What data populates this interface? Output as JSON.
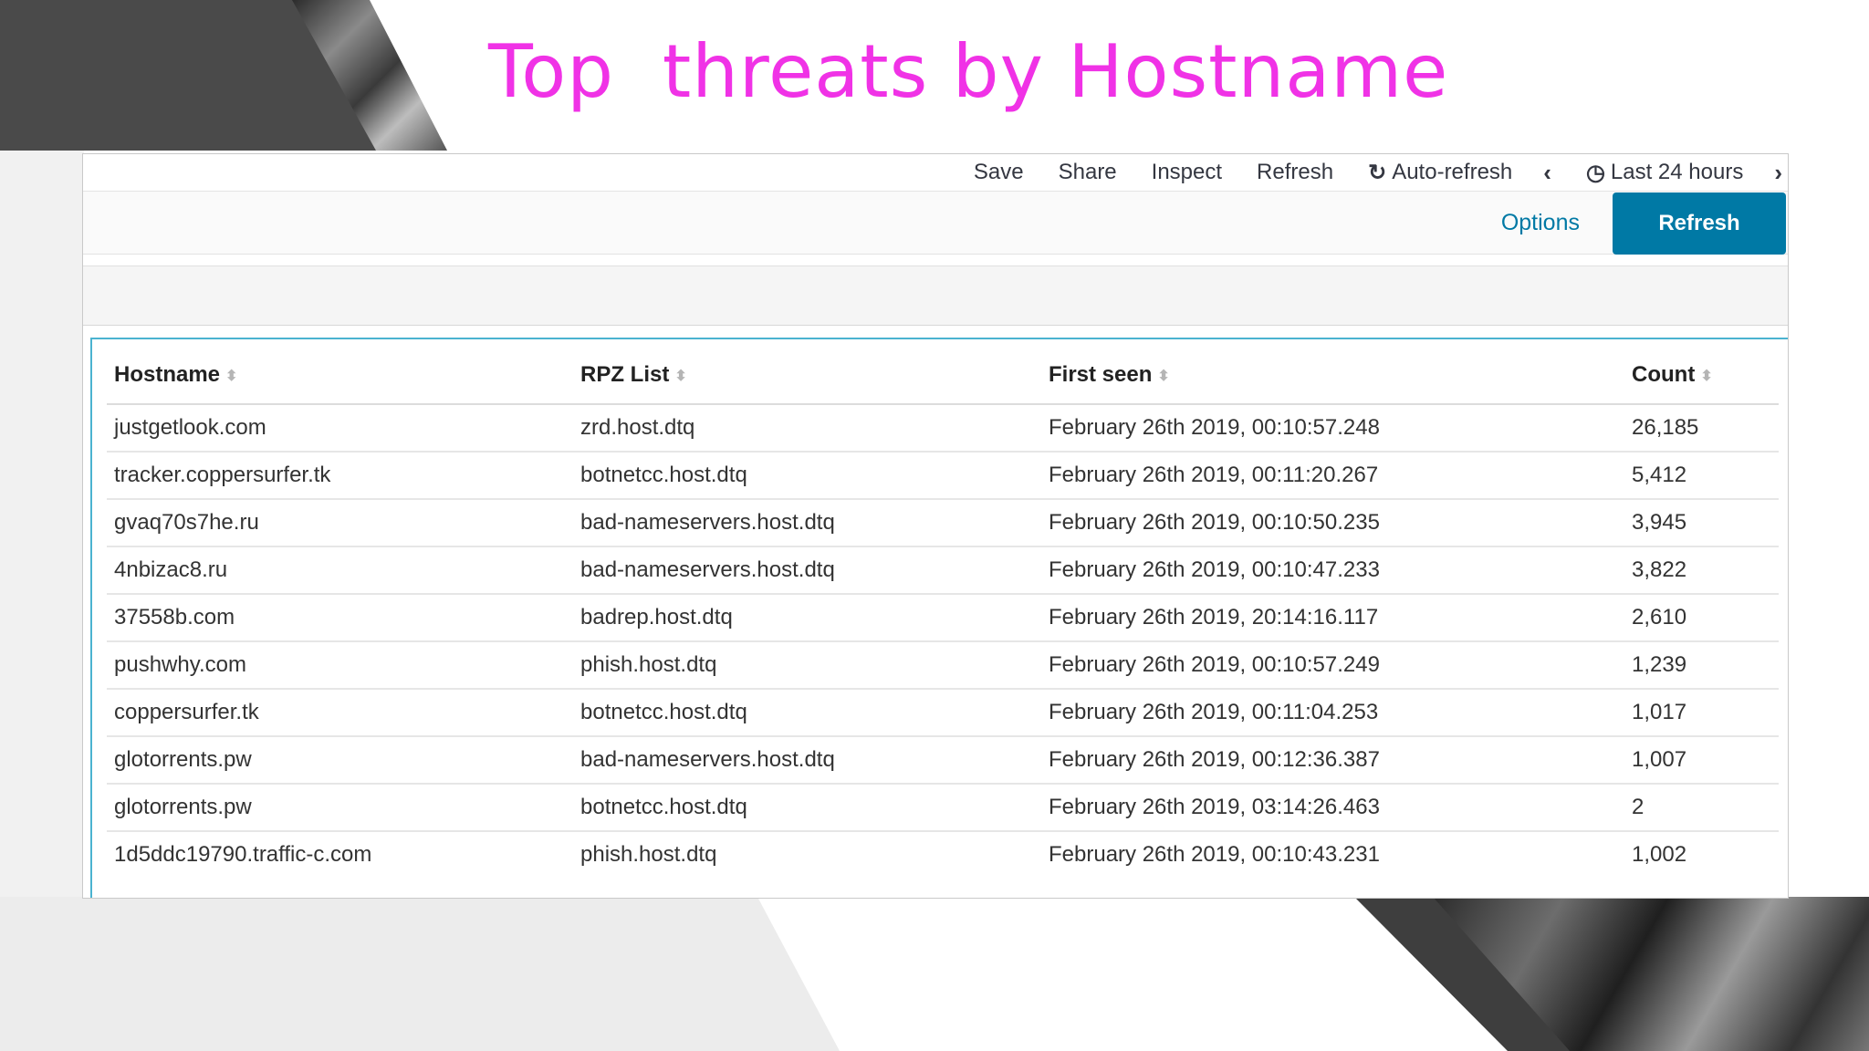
{
  "slide": {
    "title": "Top  threats by Hostname"
  },
  "nav": {
    "save": "Save",
    "share": "Share",
    "inspect": "Inspect",
    "refresh": "Refresh",
    "auto_refresh": "Auto-refresh",
    "time_range": "Last 24 hours"
  },
  "query_bar": {
    "options_label": "Options",
    "refresh_label": "Refresh"
  },
  "table": {
    "headers": [
      "Hostname",
      "RPZ List",
      "First seen",
      "Count"
    ],
    "rows": [
      [
        "justgetlook.com",
        "zrd.host.dtq",
        "February 26th 2019, 00:10:57.248",
        "26,185"
      ],
      [
        "tracker.coppersurfer.tk",
        "botnetcc.host.dtq",
        "February 26th 2019, 00:11:20.267",
        "5,412"
      ],
      [
        "gvaq70s7he.ru",
        "bad-nameservers.host.dtq",
        "February 26th 2019, 00:10:50.235",
        "3,945"
      ],
      [
        "4nbizac8.ru",
        "bad-nameservers.host.dtq",
        "February 26th 2019, 00:10:47.233",
        "3,822"
      ],
      [
        "37558b.com",
        "badrep.host.dtq",
        "February 26th 2019, 20:14:16.117",
        "2,610"
      ],
      [
        "pushwhy.com",
        "phish.host.dtq",
        "February 26th 2019, 00:10:57.249",
        "1,239"
      ],
      [
        "coppersurfer.tk",
        "botnetcc.host.dtq",
        "February 26th 2019, 00:11:04.253",
        "1,017"
      ],
      [
        "glotorrents.pw",
        "bad-nameservers.host.dtq",
        "February 26th 2019, 00:12:36.387",
        "1,007"
      ],
      [
        "glotorrents.pw",
        "botnetcc.host.dtq",
        "February 26th 2019, 03:14:26.463",
        "2"
      ],
      [
        "1d5ddc19790.traffic-c.com",
        "phish.host.dtq",
        "February 26th 2019, 00:10:43.231",
        "1,002"
      ]
    ]
  },
  "icons": {
    "sort": "sort-icon",
    "auto_refresh": "refresh-cycle-icon",
    "clock": "clock-icon",
    "prev": "chevron-left-icon",
    "next": "chevron-right-icon"
  },
  "colors": {
    "title": "#f032e6",
    "accent": "#0079a5",
    "panel_border": "#4ab3d0"
  }
}
